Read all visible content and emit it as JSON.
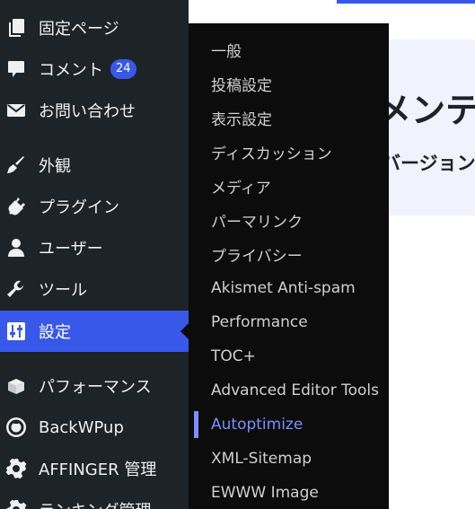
{
  "content": {
    "heading": "メンテ",
    "subheading": "バージョン"
  },
  "sidebar": {
    "items": [
      {
        "label": "固定ページ",
        "icon": "pages-icon"
      },
      {
        "label": "コメント",
        "icon": "comment-icon",
        "badge": "24"
      },
      {
        "label": "お問い合わせ",
        "icon": "mail-icon"
      },
      {
        "label": "外観",
        "icon": "paintbrush-icon"
      },
      {
        "label": "プラグイン",
        "icon": "plugin-icon"
      },
      {
        "label": "ユーザー",
        "icon": "user-icon"
      },
      {
        "label": "ツール",
        "icon": "wrench-icon"
      },
      {
        "label": "設定",
        "icon": "settings-sliders-icon",
        "active": true
      },
      {
        "label": "パフォーマンス",
        "icon": "performance-icon"
      },
      {
        "label": "BackWPup",
        "icon": "backwpup-icon"
      },
      {
        "label": "AFFINGER 管理",
        "icon": "gear-icon"
      },
      {
        "label": "ランキング管理",
        "icon": "gear-icon"
      }
    ]
  },
  "submenu": {
    "items": [
      {
        "label": "一般"
      },
      {
        "label": "投稿設定"
      },
      {
        "label": "表示設定"
      },
      {
        "label": "ディスカッション"
      },
      {
        "label": "メディア"
      },
      {
        "label": "パーマリンク"
      },
      {
        "label": "プライバシー"
      },
      {
        "label": "Akismet Anti-spam"
      },
      {
        "label": "Performance"
      },
      {
        "label": "TOC+"
      },
      {
        "label": "Advanced Editor Tools"
      },
      {
        "label": "Autoptimize",
        "current": true
      },
      {
        "label": "XML-Sitemap"
      },
      {
        "label": "EWWW Image"
      }
    ]
  },
  "colors": {
    "sidebar_bg": "#1d2327",
    "submenu_bg": "#0c0c0c",
    "accent": "#3858e9",
    "submenu_current": "#7b90ff",
    "panel_bg": "#f0f2fd"
  }
}
